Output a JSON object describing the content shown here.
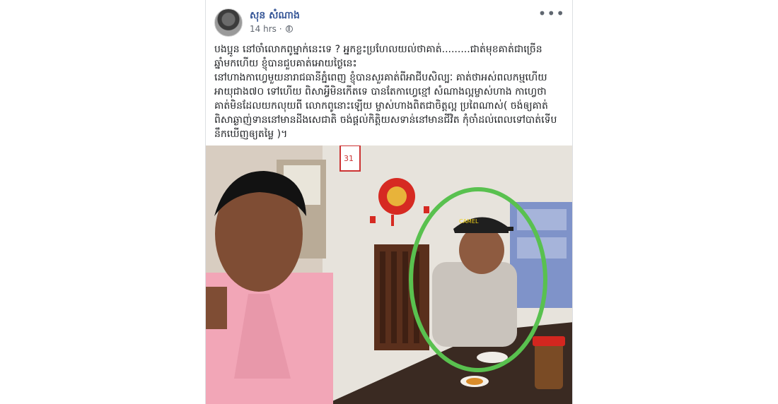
{
  "post": {
    "author": "សុន សំណាង",
    "time": "14 hrs",
    "separator": "·",
    "privacy_icon": "globe-icon",
    "more_icon": "more-options-icon",
    "text": "បងប្អូន នៅចាំលោកពូម្នាក់នេះទេ ? អ្នកខ្លះប្រហែលយល់ថាគាត់.........ជាត់មុខគាត់ជាច្រើនឆ្នាំមកហើយ ខ្ញុំបានជួបគាត់អោយថ្ងៃនេះ\nនៅហាងកាហ្វេមួយនារាជធានីភ្នំពេញ ខ្ញុំបានសួរគាត់ពីអាជីបសិល្បៈ គាត់ថាអស់ពលកម្មហើយ អាយុជាង៧០ ទៅហើយ ពិសាអ្វីមិនកើតទេ បានតែកាហ្វេខ្មៅ សំណាងល្អម្ចាស់ហាង កាហ្វេថា គាត់មិនដែលយកលុយពី លោកពូនោះឡើយ ម្ចាស់ហាងពិតជាចិត្តល្អ ប្រពៃណាស់( ចង់ឲ្យគាត់ពិសាឆ្ងាញ់ទាននៅមានដីងសេជាតិ ចង់ផ្តល់កិត្តិយសទាន់នៅមានជីវិត កុំចាំដល់ពេលទៅបាត់ទើបនឹកឃើញឲ្យតម្លៃ )។"
  },
  "photo": {
    "calendar_number": "31",
    "cap_text": "CAMEL",
    "highlight_color": "#59c14f"
  }
}
